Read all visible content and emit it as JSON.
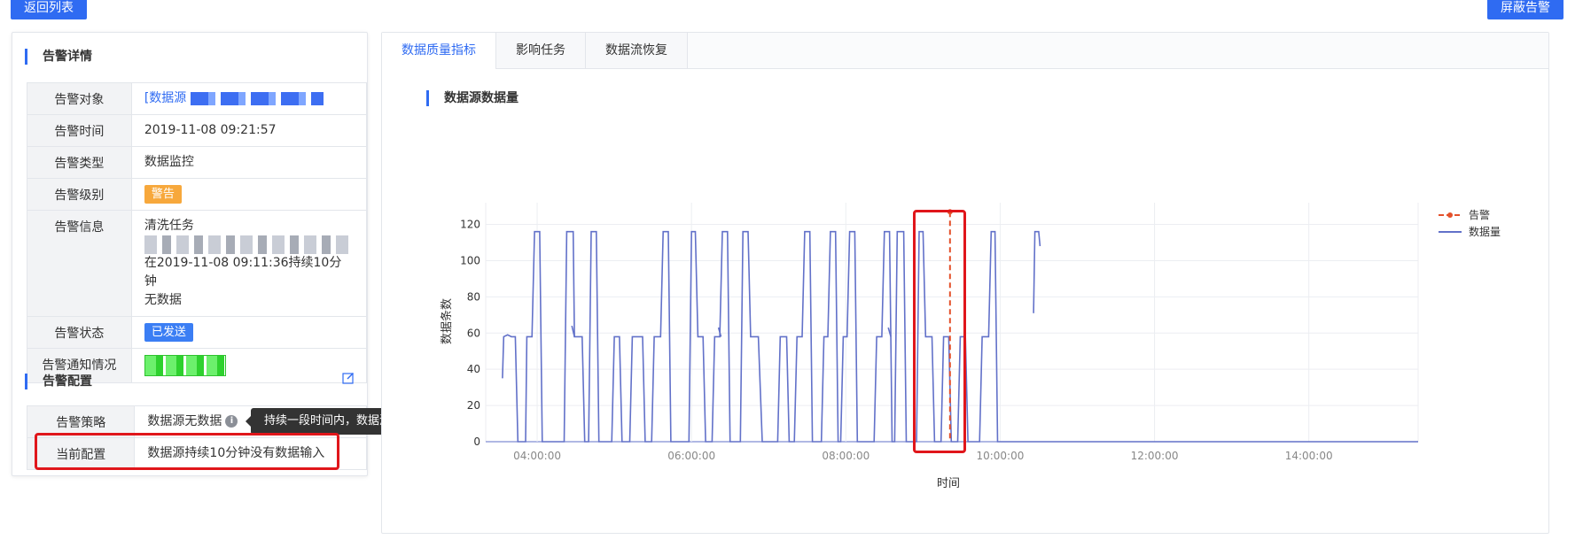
{
  "buttons": {
    "back": "返回列表",
    "shield": "屏蔽告警"
  },
  "detail": {
    "title": "告警详情",
    "rows": {
      "target": {
        "label": "告警对象",
        "value": "[数据源"
      },
      "time": {
        "label": "告警时间",
        "value": "2019-11-08 09:21:57"
      },
      "type": {
        "label": "告警类型",
        "value": "数据监控"
      },
      "level": {
        "label": "告警级别",
        "value": "警告"
      },
      "info": {
        "label": "告警信息",
        "line1": "清洗任务",
        "line3": "在2019-11-08 09:11:36持续10分钟",
        "line4": "无数据"
      },
      "status": {
        "label": "告警状态",
        "value": "已发送"
      },
      "notify": {
        "label": "告警通知情况"
      }
    }
  },
  "config": {
    "title": "告警配置",
    "strategy": {
      "label": "告警策略",
      "value": "数据源无数据"
    },
    "current": {
      "label": "当前配置",
      "value": "数据源持续10分钟没有数据输入"
    },
    "tooltip": "持续一段时间内，数据源没有任何数据产生"
  },
  "tabs": [
    "数据质量指标",
    "影响任务",
    "数据流恢复"
  ],
  "chart_section_title": "数据源数据量",
  "colors": {
    "accent": "#2f6bf2",
    "series": "#6271c9",
    "alarm": "#e4512b",
    "warn": "#f7a83c",
    "highlight": "#e0161b"
  },
  "icons": {
    "edit": "edit-icon",
    "info": "info-icon"
  },
  "chart_data": {
    "type": "line",
    "xlabel": "时间",
    "ylabel": "数据条数",
    "ylim": [
      0,
      120
    ],
    "yticks": [
      0,
      20,
      40,
      60,
      80,
      100,
      120
    ],
    "xticks": [
      "04:00:00",
      "06:00:00",
      "08:00:00",
      "10:00:00",
      "12:00:00",
      "14:00:00"
    ],
    "legend": [
      "告警",
      "数据量"
    ],
    "legend_position": "top-right",
    "grid": true,
    "series": [
      {
        "name": "数据量",
        "points": [
          [
            "03:33",
            35
          ],
          [
            "03:34",
            58
          ],
          [
            "03:37",
            59
          ],
          [
            "03:40",
            58
          ],
          [
            "03:43",
            58
          ],
          [
            "03:45",
            0
          ],
          [
            "03:51",
            0
          ],
          [
            "03:52",
            58
          ],
          [
            "03:56",
            58
          ],
          [
            "03:58",
            116
          ],
          [
            "04:02",
            116
          ],
          [
            "04:04",
            0
          ],
          [
            "04:21",
            0
          ],
          [
            "04:23",
            116
          ],
          [
            "04:28",
            116
          ],
          [
            "04:29",
            58
          ],
          [
            "04:35",
            58
          ],
          [
            "04:37",
            0
          ],
          [
            "04:40",
            0
          ],
          [
            "04:42",
            116
          ],
          [
            "04:46",
            116
          ],
          [
            "04:48",
            0
          ],
          [
            "04:58",
            0
          ],
          [
            "05:00",
            58
          ],
          [
            "05:04",
            58
          ],
          [
            "05:06",
            0
          ],
          [
            "05:12",
            0
          ],
          [
            "05:14",
            58
          ],
          [
            "05:18",
            58
          ],
          [
            "05:22",
            58
          ],
          [
            "05:24",
            0
          ],
          [
            "05:29",
            0
          ],
          [
            "05:31",
            58
          ],
          [
            "05:36",
            58
          ],
          [
            "05:38",
            116
          ],
          [
            "05:42",
            116
          ],
          [
            "05:44",
            0
          ],
          [
            "05:58",
            0
          ],
          [
            "06:00",
            116
          ],
          [
            "06:03",
            116
          ],
          [
            "06:05",
            58
          ],
          [
            "06:09",
            58
          ],
          [
            "06:11",
            0
          ],
          [
            "06:16",
            0
          ],
          [
            "06:18",
            58
          ],
          [
            "06:22",
            58
          ],
          [
            "06:24",
            116
          ],
          [
            "06:28",
            116
          ],
          [
            "06:30",
            0
          ],
          [
            "06:38",
            0
          ],
          [
            "06:40",
            116
          ],
          [
            "06:44",
            116
          ],
          [
            "06:46",
            58
          ],
          [
            "06:52",
            58
          ],
          [
            "06:55",
            0
          ],
          [
            "07:07",
            0
          ],
          [
            "07:09",
            58
          ],
          [
            "07:14",
            58
          ],
          [
            "07:16",
            0
          ],
          [
            "07:20",
            0
          ],
          [
            "07:22",
            58
          ],
          [
            "07:26",
            58
          ],
          [
            "07:28",
            116
          ],
          [
            "07:32",
            116
          ],
          [
            "07:34",
            0
          ],
          [
            "07:41",
            0
          ],
          [
            "07:43",
            58
          ],
          [
            "07:46",
            58
          ],
          [
            "07:48",
            116
          ],
          [
            "07:52",
            116
          ],
          [
            "07:54",
            0
          ],
          [
            "07:56",
            0
          ],
          [
            "07:58",
            58
          ],
          [
            "08:01",
            58
          ],
          [
            "08:03",
            116
          ],
          [
            "08:07",
            116
          ],
          [
            "08:09",
            0
          ],
          [
            "08:22",
            0
          ],
          [
            "08:24",
            58
          ],
          [
            "08:28",
            58
          ],
          [
            "08:30",
            116
          ],
          [
            "08:34",
            116
          ],
          [
            "08:36",
            0
          ],
          [
            "08:38",
            0
          ],
          [
            "08:40",
            116
          ],
          [
            "08:45",
            116
          ],
          [
            "08:47",
            0
          ],
          [
            "08:55",
            0
          ],
          [
            "08:57",
            116
          ],
          [
            "09:00",
            116
          ],
          [
            "09:02",
            58
          ],
          [
            "09:07",
            58
          ],
          [
            "09:09",
            0
          ],
          [
            "09:14",
            0
          ],
          [
            "09:16",
            58
          ],
          [
            "09:20",
            58
          ],
          [
            "09:22",
            0
          ],
          [
            "09:27",
            0
          ],
          [
            "09:29",
            58
          ],
          [
            "09:33",
            58
          ],
          [
            "09:35",
            0
          ],
          [
            "09:44",
            0
          ],
          [
            "09:46",
            58
          ],
          [
            "09:51",
            58
          ],
          [
            "09:53",
            116
          ],
          [
            "09:56",
            116
          ],
          [
            "09:58",
            0
          ],
          [
            "15:25",
            0
          ]
        ]
      },
      {
        "name": "数据量",
        "points": [
          [
            "04:27",
            64
          ],
          [
            "04:29",
            58
          ]
        ]
      },
      {
        "name": "数据量",
        "points": [
          [
            "06:21",
            63
          ],
          [
            "06:23",
            58
          ]
        ]
      },
      {
        "name": "数据量",
        "points": [
          [
            "08:33",
            63
          ],
          [
            "08:35",
            58
          ]
        ]
      },
      {
        "name": "数据量",
        "points": [
          [
            "10:26",
            71
          ],
          [
            "10:27",
            116
          ],
          [
            "10:30",
            116
          ],
          [
            "10:31",
            108
          ]
        ]
      }
    ],
    "alarm": {
      "name": "告警",
      "time": "09:21",
      "value": 127
    }
  }
}
